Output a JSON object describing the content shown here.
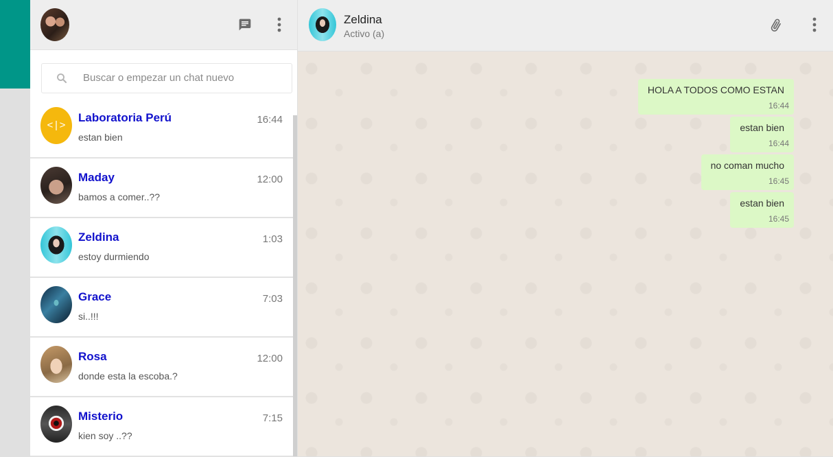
{
  "sidebar": {
    "search_placeholder": "Buscar o empezar un chat nuevo",
    "chats": [
      {
        "name": "Laboratoria Perú",
        "time": "16:44",
        "last_message": "estan bien"
      },
      {
        "name": "Maday",
        "time": "12:00",
        "last_message": "bamos a comer..??"
      },
      {
        "name": "Zeldina",
        "time": "1:03",
        "last_message": "estoy durmiendo"
      },
      {
        "name": "Grace",
        "time": "7:03",
        "last_message": "si..!!!"
      },
      {
        "name": "Rosa",
        "time": "12:00",
        "last_message": "donde esta la escoba.?"
      },
      {
        "name": "Misterio",
        "time": "7:15",
        "last_message": "kien soy ..??"
      }
    ],
    "laboratoria_logo_text": "<|>"
  },
  "conversation": {
    "contact_name": "Zeldina",
    "status": "Activo (a)",
    "messages": [
      {
        "text": "HOLA A TODOS COMO ESTAN",
        "time": "16:44"
      },
      {
        "text": "estan bien",
        "time": "16:44"
      },
      {
        "text": "no coman mucho",
        "time": "16:45"
      },
      {
        "text": "estan bien",
        "time": "16:45"
      }
    ]
  },
  "colors": {
    "accent": "#009688",
    "bubble": "#dcf8c6",
    "chat_name": "#1111cc"
  },
  "icons": {
    "new_chat": "chat-icon",
    "menu": "more-vert-icon",
    "attach": "paperclip-icon",
    "search": "search-icon"
  }
}
